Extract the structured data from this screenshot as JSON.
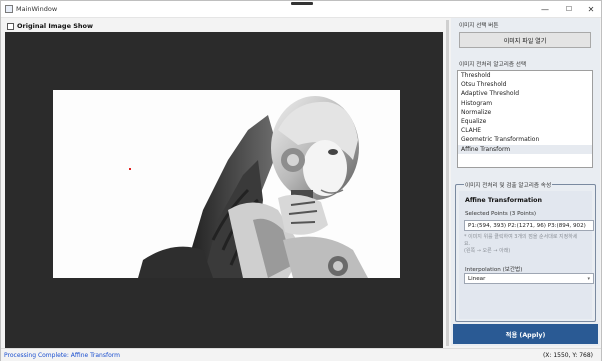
{
  "window": {
    "title": "MainWindow",
    "controls": {
      "minimize": "—",
      "maximize": "☐",
      "close": "✕"
    }
  },
  "left": {
    "original_show_label": "Original Image Show",
    "original_show_checked": false
  },
  "right": {
    "image_select_label": "이미지 선택 버튼",
    "open_file_button": "이미지 파일 열기",
    "algo_select_label": "이미지 전처리 알고리즘 선택",
    "algorithms": [
      "Threshold",
      "Otsu Threshold",
      "Adaptive Threshold",
      "Histogram",
      "Normalize",
      "Equalize",
      "CLAHE",
      "Geometric Transformation",
      "Affine Transform"
    ],
    "selected_algorithm": "Affine Transform",
    "properties_group_title": "이미지 전처리 및 검출 알고리즘 속성",
    "card": {
      "title": "Affine Transformation",
      "points_label": "Selected Points (3 Points)",
      "points_value": "P1:(594, 393) P2:(1271, 96) P3:(894, 902)",
      "hint_line1": "* 이미지 위를 클릭하여 3개의 점을 순서대로 지정하세",
      "hint_line2": "요.",
      "hint_line3": "(왼쪽 → 오른 → 아래)",
      "interpolation_label": "Interpolation (보간법)",
      "interpolation_value": "Linear"
    },
    "apply_button": "적용 (Apply)"
  },
  "status": {
    "message": "Processing Complete: Affine Transform",
    "coords": "(X: 1550, Y: 768)"
  }
}
